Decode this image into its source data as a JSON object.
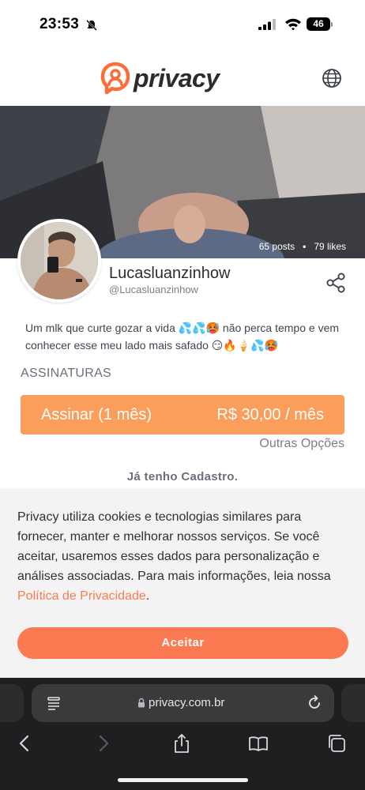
{
  "status_bar": {
    "time": "23:53",
    "battery": "46"
  },
  "header": {
    "logo_text": "privacy"
  },
  "cover": {
    "posts": "65 posts",
    "separator": "•",
    "likes": "79 likes"
  },
  "profile": {
    "name": "Lucasluanzinhow",
    "handle": "@Lucasluanzinhow",
    "bio": "Um mlk que curte gozar a vida 💦💦🥵 não perca tempo e vem conhecer esse meu lado mais safado 😏🔥🍦💦🥵"
  },
  "subscriptions": {
    "title": "ASSINATURAS",
    "plan_label": "Assinar (1 mês)",
    "plan_price": "R$ 30,00 / mês",
    "other_options": "Outras Opções",
    "login": "Já tenho Cadastro."
  },
  "cookie": {
    "text": "Privacy utiliza cookies e tecnologias similares para fornecer, manter e melhorar nossos serviços. Se você aceitar, usaremos esses dados para personalização e análises associadas. Para mais informações, leia nossa ",
    "link": "Política de Privacidade",
    "end": ".",
    "accept": "Aceitar"
  },
  "browser": {
    "url": "privacy.com.br"
  },
  "colors": {
    "accent": "#fb9e5c",
    "accept": "#fc7a51"
  }
}
